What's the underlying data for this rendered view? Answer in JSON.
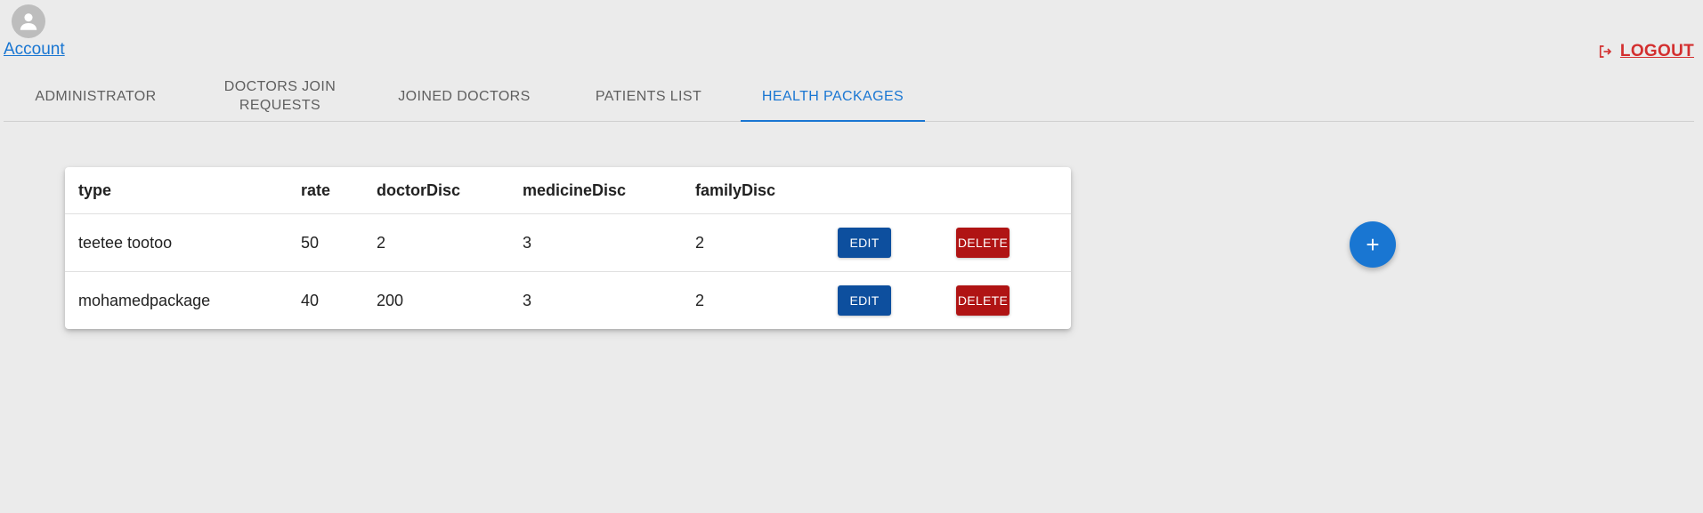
{
  "header": {
    "account_label": "Account",
    "logout_label": "LOGOUT",
    "avatar_icon": "person-icon",
    "logout_icon": "logout-icon"
  },
  "tabs": [
    {
      "label": "ADMINISTRATOR",
      "active": false
    },
    {
      "label": "DOCTORS JOIN REQUESTS",
      "active": false
    },
    {
      "label": "JOINED DOCTORS",
      "active": false
    },
    {
      "label": "PATIENTS LIST",
      "active": false
    },
    {
      "label": "HEALTH PACKAGES",
      "active": true
    }
  ],
  "table": {
    "columns": [
      "type",
      "rate",
      "doctorDisc",
      "medicineDisc",
      "familyDisc"
    ],
    "rows": [
      {
        "type": "teetee tootoo",
        "rate": "50",
        "doctorDisc": "2",
        "medicineDisc": "3",
        "familyDisc": "2"
      },
      {
        "type": "mohamedpackage",
        "rate": "40",
        "doctorDisc": "200",
        "medicineDisc": "3",
        "familyDisc": "2"
      }
    ],
    "edit_label": "EDIT",
    "delete_label": "DELETE"
  },
  "fab": {
    "label": "+",
    "icon": "plus-icon"
  },
  "colors": {
    "primary": "#1976d2",
    "logout": "#d32f2f",
    "edit_button": "#0d4f9e",
    "delete_button": "#b01414",
    "background": "#ebebeb"
  }
}
